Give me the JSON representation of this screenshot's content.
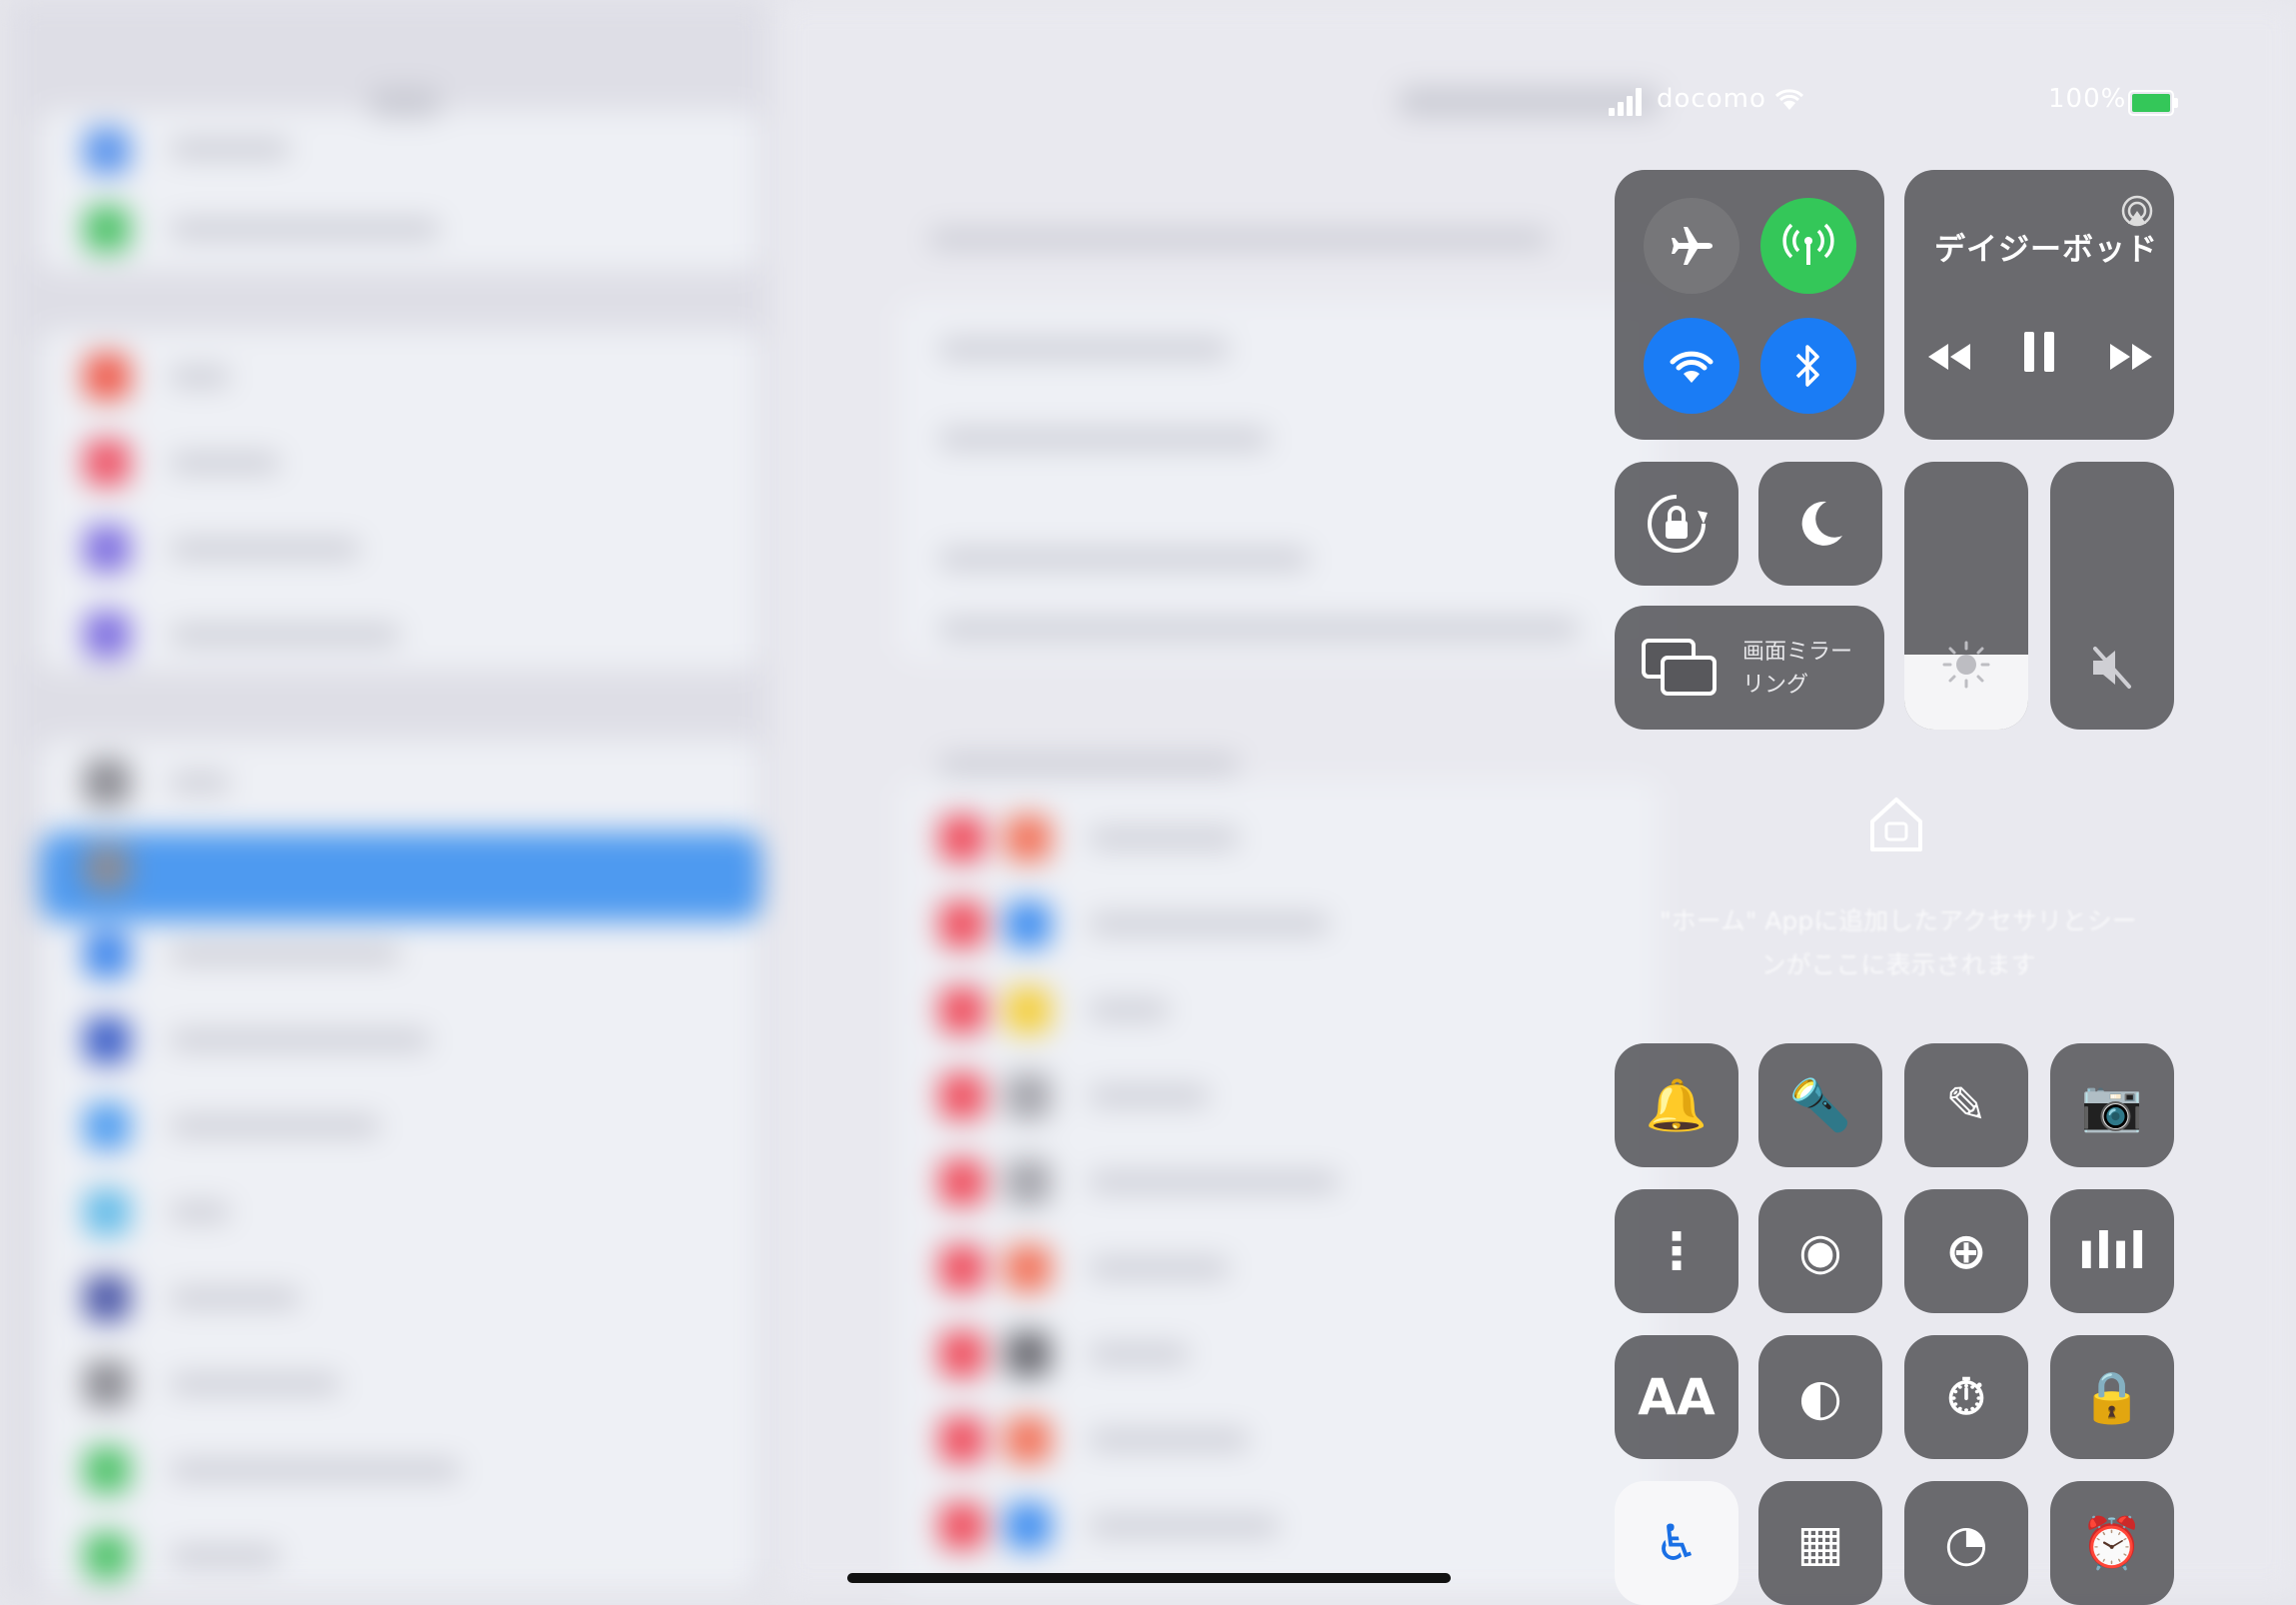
{
  "status_bar": {
    "carrier": "docomo",
    "battery_percent": "100%",
    "icons": [
      "signal-icon",
      "wifi-icon",
      "battery-charging-icon"
    ]
  },
  "control_center": {
    "connectivity": {
      "airplane_mode": {
        "icon": "airplane-icon",
        "on": false
      },
      "cellular_data": {
        "icon": "cellular-antenna-icon",
        "on": true,
        "color": "#34c759"
      },
      "wifi": {
        "icon": "wifi-icon",
        "on": true,
        "color": "#1a7cf5"
      },
      "bluetooth": {
        "icon": "bluetooth-icon",
        "on": true,
        "color": "#1a7cf5"
      }
    },
    "media": {
      "title": "デイジーボッド",
      "airplay_icon": "airplay-icon",
      "controls": [
        "rewind-icon",
        "pause-icon",
        "fast-forward-icon"
      ]
    },
    "orientation_lock": {
      "icon": "rotation-lock-icon"
    },
    "do_not_disturb": {
      "icon": "moon-icon"
    },
    "screen_mirroring": {
      "icon": "screen-mirroring-icon",
      "label": "画面ミラーリング"
    },
    "brightness": {
      "icon": "sun-icon",
      "level": 0.28
    },
    "volume": {
      "icon": "speaker-muted-icon",
      "level": 0.0
    },
    "home": {
      "icon": "home-icon",
      "message": "\"ホーム\" Appに追加したアクセサリとシーンがここに表示されます"
    },
    "buttons": [
      {
        "name": "bell-icon",
        "glyph": "🔔"
      },
      {
        "name": "flashlight-icon",
        "glyph": "🔦"
      },
      {
        "name": "notes-icon",
        "glyph": "✎"
      },
      {
        "name": "camera-icon",
        "glyph": "📷"
      },
      {
        "name": "apple-tv-remote-icon",
        "glyph": "⋮"
      },
      {
        "name": "screen-recording-icon",
        "glyph": "◉"
      },
      {
        "name": "magnifier-icon",
        "glyph": "⊕"
      },
      {
        "name": "voice-memo-icon",
        "glyph": "ılıl"
      },
      {
        "name": "text-size-icon",
        "glyph": "AA"
      },
      {
        "name": "dark-mode-icon",
        "glyph": "◐"
      },
      {
        "name": "timer-icon",
        "glyph": "⏱"
      },
      {
        "name": "guided-access-icon",
        "glyph": "🔒"
      },
      {
        "name": "accessibility-icon",
        "glyph": "♿"
      },
      {
        "name": "qr-code-scanner-icon",
        "glyph": "▦"
      },
      {
        "name": "stopwatch-icon",
        "glyph": "◔"
      },
      {
        "name": "alarm-icon",
        "glyph": "⏰"
      }
    ]
  },
  "colors": {
    "active_green": "#34c759",
    "active_blue": "#1a7cf5",
    "tile_gray": "#58585c"
  }
}
